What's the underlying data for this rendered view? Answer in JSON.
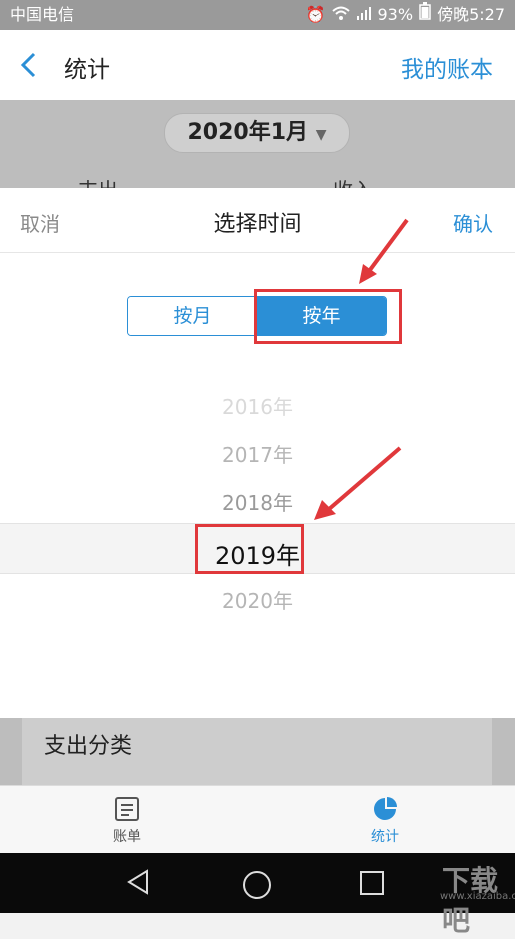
{
  "status": {
    "carrier": "中国电信",
    "battery": "93%",
    "time": "傍晚5:27"
  },
  "header": {
    "title": "统计",
    "right_link": "我的账本"
  },
  "background": {
    "month_selector": "2020年1月",
    "col_left": "支出",
    "col_right": "收入",
    "section_title": "支出分类"
  },
  "sheet": {
    "cancel": "取消",
    "title": "选择时间",
    "confirm": "确认",
    "segments": [
      {
        "label": "按月",
        "active": false
      },
      {
        "label": "按年",
        "active": true
      }
    ],
    "years": [
      "2016年",
      "2017年",
      "2018年",
      "2019年",
      "2020年"
    ],
    "selected_year": "2019年"
  },
  "tabbar": {
    "items": [
      {
        "label": "账单",
        "icon": "bill-icon"
      },
      {
        "label": "统计",
        "icon": "pie-chart-icon"
      }
    ]
  },
  "accent_color": "#2b8fd6",
  "highlight_color": "#e0383b",
  "watermark": {
    "text": "下载吧",
    "url": "www.xiazaiba.com"
  }
}
